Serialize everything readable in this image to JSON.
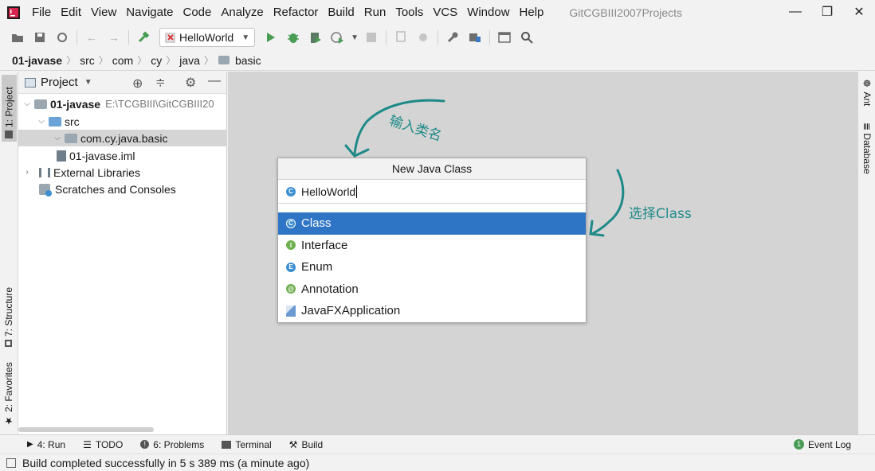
{
  "menubar": {
    "items": [
      "File",
      "Edit",
      "View",
      "Navigate",
      "Code",
      "Analyze",
      "Refactor",
      "Build",
      "Run",
      "Tools",
      "VCS",
      "Window",
      "Help"
    ],
    "title": "GitCGBIII2007Projects"
  },
  "toolbar": {
    "run_config": "HelloWorld"
  },
  "breadcrumb": [
    "01-javase",
    "src",
    "com",
    "cy",
    "java",
    "basic"
  ],
  "project_panel": {
    "title": "Project",
    "tree": [
      {
        "label": "01-javase",
        "path": "E:\\TCGBIII\\GitCGBIII20",
        "level": 0,
        "expanded": true
      },
      {
        "label": "src",
        "level": 1,
        "expanded": true
      },
      {
        "label": "com.cy.java.basic",
        "level": 2,
        "expanded": true,
        "selected": true
      },
      {
        "label": "01-javase.iml",
        "level": 1
      },
      {
        "label": "External Libraries",
        "level": 0,
        "expanded": false
      },
      {
        "label": "Scratches and Consoles",
        "level": 0
      }
    ]
  },
  "left_tabs": {
    "project": "1: Project",
    "structure": "7: Structure",
    "favorites": "2: Favorites"
  },
  "right_tabs": {
    "ant": "Ant",
    "database": "Database"
  },
  "dialog": {
    "title": "New Java Class",
    "input_value": "HelloWorld",
    "options": [
      {
        "label": "Class",
        "icon": "C",
        "color": "#3d8fd1",
        "selected": true
      },
      {
        "label": "Interface",
        "icon": "I",
        "color": "#6fb04f"
      },
      {
        "label": "Enum",
        "icon": "E",
        "color": "#3d8fd1"
      },
      {
        "label": "Annotation",
        "icon": "@",
        "color": "#6fb04f"
      },
      {
        "label": "JavaFXApplication",
        "icon": "javafx-icon",
        "color": "#6a9ad1"
      }
    ]
  },
  "annotations": {
    "top": "输入类名",
    "right": "选择Class"
  },
  "bottom_tabs": {
    "run": "4: Run",
    "todo": "TODO",
    "problems": "6: Problems",
    "terminal": "Terminal",
    "build": "Build",
    "event_log": "Event Log",
    "event_count": "1"
  },
  "status": "Build completed successfully in 5 s 389 ms (a minute ago)"
}
